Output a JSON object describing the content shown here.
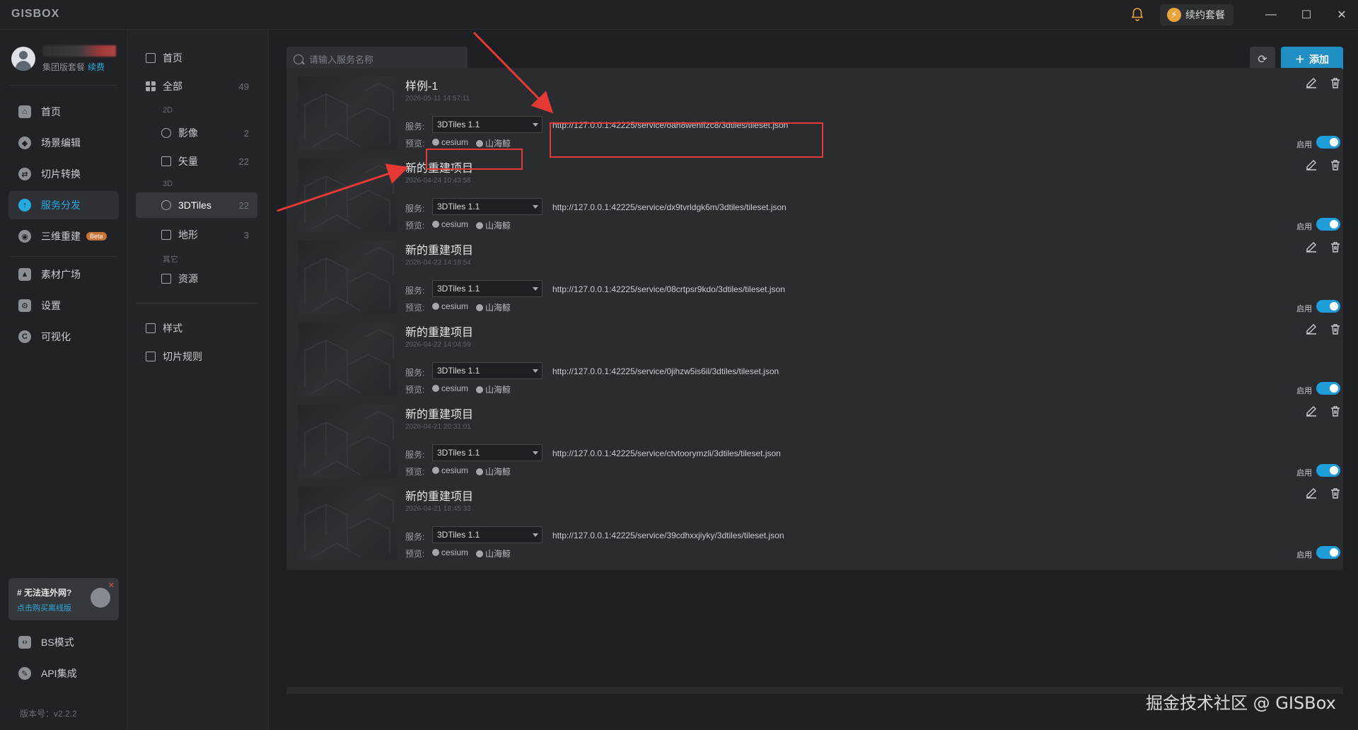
{
  "app": {
    "brand": "GISBOX",
    "renew_label": "续约套餐",
    "window_controls": [
      "minimize-icon",
      "maximize-icon",
      "close-icon"
    ]
  },
  "user": {
    "plan": "集团版套餐",
    "renew_link": "续费"
  },
  "sidebar": {
    "items": [
      {
        "label": "首页",
        "icon": "home-icon"
      },
      {
        "label": "场景编辑",
        "icon": "cube-icon"
      },
      {
        "label": "切片转换",
        "icon": "convert-icon"
      },
      {
        "label": "服务分发",
        "icon": "cloud-upload-icon",
        "active": true
      },
      {
        "label": "三维重建",
        "icon": "reconstruct-icon",
        "badge": "Beta"
      },
      {
        "label": "素材广场",
        "icon": "image-icon"
      },
      {
        "label": "设置",
        "icon": "gear-icon"
      },
      {
        "label": "可视化",
        "icon": "chart-icon"
      }
    ],
    "promo_title": "# 无法连外网?",
    "promo_link": "点击购买离线版",
    "bottom_items": [
      {
        "label": "BS模式",
        "icon": "code-icon"
      },
      {
        "label": "API集成",
        "icon": "api-icon"
      }
    ],
    "version": "版本号：v2.2.2"
  },
  "subnav": {
    "home": "首页",
    "all": {
      "label": "全部",
      "count": "49"
    },
    "group_2d": "2D",
    "imagery": {
      "label": "影像",
      "count": "2"
    },
    "vector": {
      "label": "矢量",
      "count": "22"
    },
    "group_3d": "3D",
    "tiles3d": {
      "label": "3DTiles",
      "count": "22"
    },
    "terrain": {
      "label": "地形",
      "count": "3"
    },
    "group_other": "其它",
    "resources": {
      "label": "资源"
    },
    "style": "样式",
    "tile_rules": "切片规则"
  },
  "toolbar": {
    "search_placeholder": "请输入服务名称",
    "add_label": "添加"
  },
  "card_labels": {
    "service": "服务:",
    "preview": "预览:",
    "cesium": "cesium",
    "shanhai": "山海鲸",
    "enable": "启用"
  },
  "services": [
    {
      "title": "样例-1",
      "date": "2026-05-11 14:57:11",
      "type": "3DTiles 1.1",
      "url": "http://127.0.0.1:42225/service/oah8wenffzc8/3dtiles/tileset.json",
      "enabled": true
    },
    {
      "title": "新的重建项目",
      "date": "2026-04-24 10:43:58",
      "type": "3DTiles 1.1",
      "url": "http://127.0.0.1:42225/service/dx9tvrldgk6m/3dtiles/tileset.json",
      "enabled": true
    },
    {
      "title": "新的重建项目",
      "date": "2026-04-22 14:18:54",
      "type": "3DTiles 1.1",
      "url": "http://127.0.0.1:42225/service/08crtpsr9kdo/3dtiles/tileset.json",
      "enabled": true
    },
    {
      "title": "新的重建项目",
      "date": "2026-04-22 14:04:59",
      "type": "3DTiles 1.1",
      "url": "http://127.0.0.1:42225/service/0jihzw5is6il/3dtiles/tileset.json",
      "enabled": true
    },
    {
      "title": "新的重建项目",
      "date": "2026-04-21 20:31:01",
      "type": "3DTiles 1.1",
      "url": "http://127.0.0.1:42225/service/ctvtoorymzli/3dtiles/tileset.json",
      "enabled": true
    },
    {
      "title": "新的重建项目",
      "date": "2026-04-21 18:45:33",
      "type": "3DTiles 1.1",
      "url": "http://127.0.0.1:42225/service/39cdhxxjiyky/3dtiles/tileset.json",
      "enabled": true
    }
  ],
  "watermark": "掘金技术社区 @ GISBox",
  "colors": {
    "accent": "#1f9ed8",
    "annotation": "#e53935"
  }
}
